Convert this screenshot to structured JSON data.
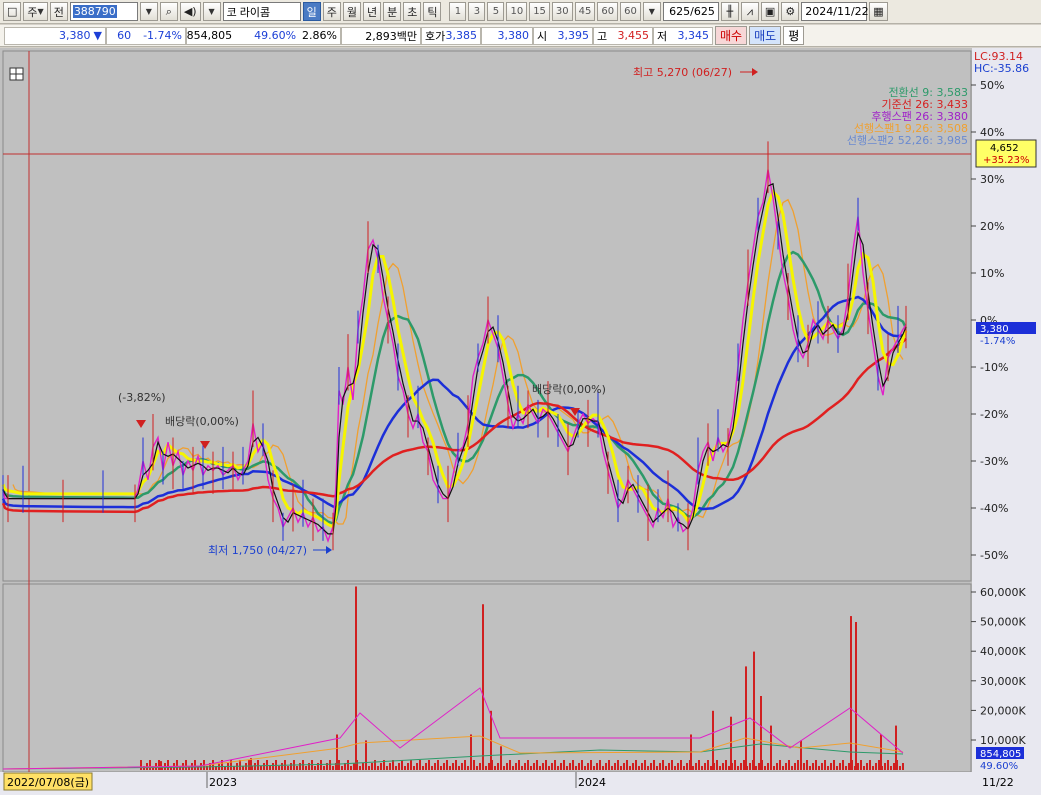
{
  "toolbar": {
    "market_label": "주",
    "prev_label": "전",
    "stock_code": "388790",
    "stock_name": "라이콤",
    "market_prefix": "코",
    "period_tabs": [
      "일",
      "주",
      "월",
      "년",
      "분",
      "초",
      "틱"
    ],
    "interval_values": [
      "1",
      "3",
      "5",
      "10",
      "15",
      "30",
      "45",
      "60",
      "60"
    ],
    "data_count": "625/625",
    "date": "2024/11/22"
  },
  "quote": {
    "price": "3,380",
    "change": "60",
    "change_pct": "-1.74%",
    "volume": "854,805",
    "volume_ratio": "49.60%",
    "turnover_pct": "2.86%",
    "amount": "2,893백만",
    "bid_label": "호가",
    "bid1": "3,385",
    "bid2": "3,380",
    "open_label": "시",
    "open": "3,395",
    "high_label": "고",
    "high": "3,455",
    "low_label": "저",
    "low": "3,345",
    "buy_label": "매수",
    "sell_label": "매도",
    "eval_label": "평"
  },
  "chart_data": {
    "type": "candlestick",
    "x_start": "2022/07/08(금)",
    "x_end": "11/22",
    "x_ticks": [
      "2023",
      "2024"
    ],
    "y_ticks_pct": [
      "50%",
      "40%",
      "30%",
      "20%",
      "10%",
      "0%",
      "-10%",
      "-20%",
      "-30%",
      "-40%",
      "-50%"
    ],
    "lc": "LC:93.14",
    "hc": "HC:-35.86",
    "current_price_tag": "3,380",
    "current_pct_tag": "-1.74%",
    "crosshair_price": "4,652",
    "crosshair_pct": "+35.23%",
    "legend": [
      {
        "label": "전환선 9: 3,583",
        "color": "#2d9a6a"
      },
      {
        "label": "기준선 26: 3,433",
        "color": "#d62020"
      },
      {
        "label": "후행스팬 26: 3,380",
        "color": "#a020c8"
      },
      {
        "label": "선행스팬1 9,26: 3,508",
        "color": "#f0a030"
      },
      {
        "label": "선행스팬2 52,26: 3,985",
        "color": "#6a8ad0"
      }
    ],
    "annotations": {
      "high": "최고 5,270 (06/27)",
      "low": "최저 1,750 (04/27)",
      "pct_note": "(-3,82%)",
      "div1": "배당락(0,00%)",
      "div2": "배당락(0,00%)"
    },
    "volume_ticks": [
      "60,000K",
      "50,000K",
      "40,000K",
      "30,000K",
      "20,000K",
      "10,000K"
    ],
    "volume_tag": "854,805",
    "volume_pct_tag": "49.60%",
    "price_path": [
      [
        0,
        -36
      ],
      [
        2,
        -38
      ],
      [
        5,
        -38
      ],
      [
        10,
        -38
      ],
      [
        20,
        -38
      ],
      [
        40,
        -38
      ],
      [
        60,
        -38
      ],
      [
        80,
        -38
      ],
      [
        100,
        -38
      ],
      [
        120,
        -38
      ],
      [
        132,
        -38
      ],
      [
        135,
        -36
      ],
      [
        140,
        -30
      ],
      [
        145,
        -34
      ],
      [
        150,
        -27
      ],
      [
        155,
        -25
      ],
      [
        160,
        -32
      ],
      [
        165,
        -26
      ],
      [
        170,
        -31
      ],
      [
        175,
        -28
      ],
      [
        180,
        -33
      ],
      [
        185,
        -30
      ],
      [
        190,
        -32
      ],
      [
        195,
        -29
      ],
      [
        200,
        -33
      ],
      [
        205,
        -31
      ],
      [
        210,
        -32
      ],
      [
        215,
        -31
      ],
      [
        220,
        -33
      ],
      [
        225,
        -32
      ],
      [
        230,
        -31
      ],
      [
        235,
        -34
      ],
      [
        240,
        -32
      ],
      [
        245,
        -30
      ],
      [
        250,
        -22
      ],
      [
        255,
        -28
      ],
      [
        260,
        -26
      ],
      [
        265,
        -34
      ],
      [
        270,
        -38
      ],
      [
        275,
        -40
      ],
      [
        280,
        -44
      ],
      [
        285,
        -42
      ],
      [
        290,
        -40
      ],
      [
        295,
        -43
      ],
      [
        300,
        -41
      ],
      [
        305,
        -44
      ],
      [
        310,
        -42
      ],
      [
        315,
        -45
      ],
      [
        320,
        -44
      ],
      [
        325,
        -47
      ],
      [
        330,
        -44
      ],
      [
        333,
        -35
      ],
      [
        336,
        -15
      ],
      [
        340,
        -18
      ],
      [
        345,
        -10
      ],
      [
        350,
        -17
      ],
      [
        355,
        -2
      ],
      [
        360,
        5
      ],
      [
        365,
        15
      ],
      [
        370,
        17
      ],
      [
        375,
        13
      ],
      [
        380,
        5
      ],
      [
        385,
        0
      ],
      [
        390,
        -5
      ],
      [
        395,
        -12
      ],
      [
        400,
        -15
      ],
      [
        405,
        -20
      ],
      [
        410,
        -23
      ],
      [
        415,
        -20
      ],
      [
        420,
        -26
      ],
      [
        425,
        -28
      ],
      [
        430,
        -34
      ],
      [
        435,
        -36
      ],
      [
        440,
        -38
      ],
      [
        445,
        -38
      ],
      [
        450,
        -33
      ],
      [
        455,
        -28
      ],
      [
        460,
        -27
      ],
      [
        465,
        -22
      ],
      [
        470,
        -12
      ],
      [
        475,
        -8
      ],
      [
        480,
        -5
      ],
      [
        485,
        0
      ],
      [
        490,
        -3
      ],
      [
        495,
        -6
      ],
      [
        500,
        -12
      ],
      [
        505,
        -18
      ],
      [
        510,
        -23
      ],
      [
        515,
        -20
      ],
      [
        520,
        -22
      ],
      [
        525,
        -18
      ],
      [
        530,
        -20
      ],
      [
        535,
        -22
      ],
      [
        540,
        -19
      ],
      [
        545,
        -20
      ],
      [
        550,
        -22
      ],
      [
        555,
        -24
      ],
      [
        560,
        -26
      ],
      [
        565,
        -28
      ],
      [
        570,
        -25
      ],
      [
        575,
        -22
      ],
      [
        580,
        -20
      ],
      [
        585,
        -22
      ],
      [
        590,
        -21
      ],
      [
        595,
        -22
      ],
      [
        600,
        -28
      ],
      [
        605,
        -32
      ],
      [
        610,
        -36
      ],
      [
        615,
        -40
      ],
      [
        620,
        -38
      ],
      [
        625,
        -34
      ],
      [
        630,
        -36
      ],
      [
        635,
        -38
      ],
      [
        640,
        -40
      ],
      [
        645,
        -42
      ],
      [
        650,
        -44
      ],
      [
        655,
        -40
      ],
      [
        660,
        -42
      ],
      [
        665,
        -38
      ],
      [
        670,
        -44
      ],
      [
        675,
        -42
      ],
      [
        680,
        -45
      ],
      [
        685,
        -44
      ],
      [
        690,
        -40
      ],
      [
        695,
        -32
      ],
      [
        700,
        -28
      ],
      [
        705,
        -26
      ],
      [
        710,
        -30
      ],
      [
        715,
        -25
      ],
      [
        720,
        -28
      ],
      [
        725,
        -26
      ],
      [
        730,
        -20
      ],
      [
        735,
        -10
      ],
      [
        740,
        0
      ],
      [
        745,
        8
      ],
      [
        750,
        15
      ],
      [
        755,
        22
      ],
      [
        760,
        25
      ],
      [
        765,
        32
      ],
      [
        770,
        26
      ],
      [
        775,
        18
      ],
      [
        780,
        10
      ],
      [
        785,
        5
      ],
      [
        790,
        -2
      ],
      [
        795,
        -6
      ],
      [
        800,
        -8
      ],
      [
        805,
        -5
      ],
      [
        810,
        0
      ],
      [
        815,
        -2
      ],
      [
        820,
        -4
      ],
      [
        825,
        0
      ],
      [
        830,
        -2
      ],
      [
        835,
        -4
      ],
      [
        840,
        -2
      ],
      [
        845,
        5
      ],
      [
        850,
        15
      ],
      [
        855,
        22
      ],
      [
        860,
        10
      ],
      [
        865,
        2
      ],
      [
        870,
        -5
      ],
      [
        875,
        -12
      ],
      [
        880,
        -16
      ],
      [
        885,
        -8
      ],
      [
        890,
        -6
      ],
      [
        895,
        -4
      ],
      [
        900,
        -2
      ],
      [
        903,
        -1
      ]
    ],
    "volume_bars": [
      [
        140,
        2
      ],
      [
        160,
        3
      ],
      [
        250,
        4
      ],
      [
        336,
        12
      ],
      [
        355,
        62
      ],
      [
        365,
        10
      ],
      [
        470,
        12
      ],
      [
        482,
        56
      ],
      [
        490,
        20
      ],
      [
        500,
        8
      ],
      [
        690,
        12
      ],
      [
        712,
        20
      ],
      [
        730,
        18
      ],
      [
        745,
        35
      ],
      [
        753,
        40
      ],
      [
        760,
        25
      ],
      [
        770,
        15
      ],
      [
        800,
        10
      ],
      [
        850,
        52
      ],
      [
        855,
        50
      ],
      [
        880,
        12
      ],
      [
        895,
        15
      ]
    ]
  }
}
